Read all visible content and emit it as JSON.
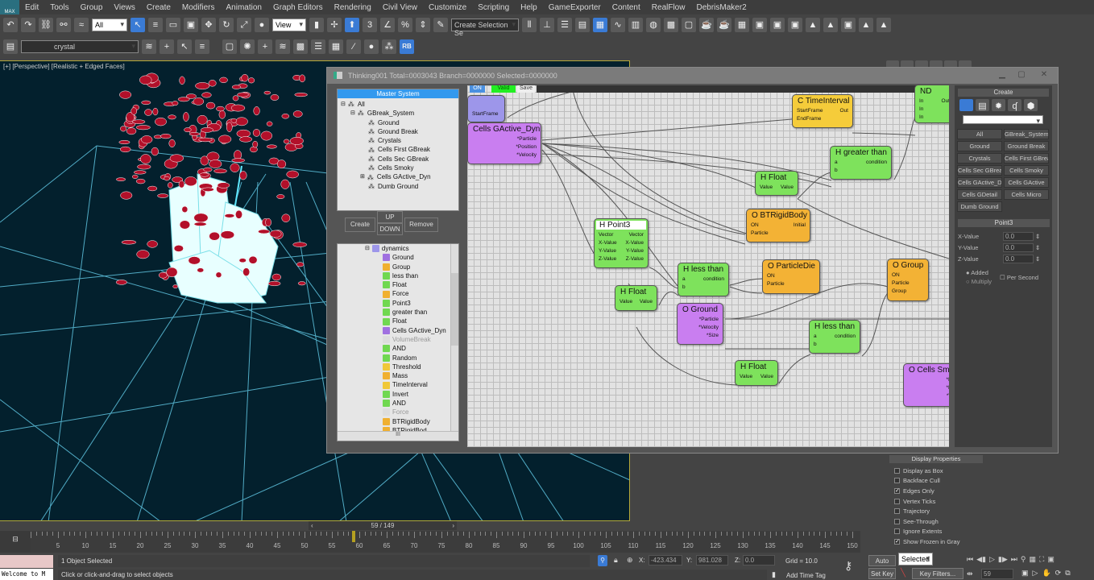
{
  "app": {
    "logo": "MAX"
  },
  "menu": [
    "Edit",
    "Tools",
    "Group",
    "Views",
    "Create",
    "Modifiers",
    "Animation",
    "Graph Editors",
    "Rendering",
    "Civil View",
    "Customize",
    "Scripting",
    "Help",
    "GameExporter",
    "Content",
    "RealFlow",
    "DebrisMaker2"
  ],
  "toolbar": {
    "selection_filter": "All",
    "ref_coord": "View",
    "named_selection": "Create Selection Se",
    "snap_labels": [
      "3",
      "%"
    ],
    "layer": "crystal",
    "rb_label": "RB"
  },
  "viewport": {
    "label": "[+] [Perspective] [Realistic + Edged Faces]"
  },
  "thinking": {
    "title": "Thinking001  Total=0003043  Branch=0000000  Selected=0000000",
    "master_header": "Master System",
    "master_tree": [
      {
        "label": "All",
        "depth": 0,
        "exp": "−"
      },
      {
        "label": "GBreak_System",
        "depth": 1,
        "exp": "−"
      },
      {
        "label": "Ground",
        "depth": 2
      },
      {
        "label": "Ground Break",
        "depth": 2
      },
      {
        "label": "Crystals",
        "depth": 2
      },
      {
        "label": "Cells First GBreak",
        "depth": 2
      },
      {
        "label": "Cells Sec GBreak",
        "depth": 2
      },
      {
        "label": "Cells Smoky",
        "depth": 2
      },
      {
        "label": "Cells GActive_Dyn",
        "depth": 2,
        "exp": "+"
      },
      {
        "label": "Dumb Ground",
        "depth": 2
      }
    ],
    "buttons": {
      "create": "Create",
      "up": "UP",
      "down": "DOWN",
      "remove": "Remove"
    },
    "dyn_root": "dynamics",
    "dyn_list": [
      {
        "label": "Ground",
        "c": "#a070e0"
      },
      {
        "label": "Group",
        "c": "#f0b030"
      },
      {
        "label": "less than",
        "c": "#70d850"
      },
      {
        "label": "Float",
        "c": "#70d850"
      },
      {
        "label": "Force",
        "c": "#f0b030"
      },
      {
        "label": "Point3",
        "c": "#70d850"
      },
      {
        "label": "greater than",
        "c": "#70d850"
      },
      {
        "label": "Float",
        "c": "#70d850"
      },
      {
        "label": "Cells GActive_Dyn",
        "c": "#a070e0"
      },
      {
        "label": "VolumeBreak",
        "c": "#ddd",
        "dim": true
      },
      {
        "label": "AND",
        "c": "#70d850"
      },
      {
        "label": "Random",
        "c": "#70d850"
      },
      {
        "label": "Threshold",
        "c": "#f0c838"
      },
      {
        "label": "Mass",
        "c": "#f0b030"
      },
      {
        "label": "TimeInterval",
        "c": "#f0c838"
      },
      {
        "label": "Invert",
        "c": "#70d850"
      },
      {
        "label": "AND",
        "c": "#70d850"
      },
      {
        "label": "Force",
        "c": "#ddd",
        "dim": true
      },
      {
        "label": "BTRigidBody",
        "c": "#f0b030"
      },
      {
        "label": "BTRigidBod",
        "c": "#f0b030"
      }
    ],
    "hscroll_mark": "III",
    "graph_tabs": {
      "on": "ON",
      "valid": "Valid",
      "save": "Save"
    },
    "nodes": {
      "startframe": {
        "ports": [
          [
            "StartFrame",
            ""
          ]
        ]
      },
      "cells_gactive": {
        "title": "Cells GActive_Dyn",
        "ports": [
          [
            "",
            "*Particle"
          ],
          [
            "",
            "*Position"
          ],
          [
            "",
            "*Velocity"
          ]
        ]
      },
      "timeinterval": {
        "title": "C TimeInterval",
        "ports": [
          [
            "StartFrame",
            "Out"
          ],
          [
            "EndFrame",
            ""
          ]
        ]
      },
      "and": {
        "title": "ND",
        "ports": [
          [
            "In",
            "Out"
          ],
          [
            "In",
            ""
          ],
          [
            "In",
            ""
          ]
        ]
      },
      "greater": {
        "title": "H greater than",
        "ports": [
          [
            "a",
            "condition"
          ],
          [
            "b",
            ""
          ]
        ]
      },
      "float1": {
        "title": "H Float",
        "ports": [
          [
            "Value",
            "Value"
          ]
        ]
      },
      "btrigid": {
        "title": "O BTRigidBody",
        "ports": [
          [
            "ON",
            "Initial"
          ],
          [
            "Particle",
            ""
          ]
        ]
      },
      "point3": {
        "title": "H Point3",
        "ports": [
          [
            "Vector",
            "Vector"
          ],
          [
            "X-Value",
            "X-Value"
          ],
          [
            "Y-Value",
            "Y-Value"
          ],
          [
            "Z-Value",
            "Z-Value"
          ]
        ]
      },
      "less1": {
        "title": "H less than",
        "ports": [
          [
            "a",
            "condition"
          ],
          [
            "b",
            ""
          ]
        ]
      },
      "particledie": {
        "title": "O ParticleDie",
        "ports": [
          [
            "ON",
            ""
          ],
          [
            "Particle",
            ""
          ]
        ]
      },
      "group": {
        "title": "O Group",
        "ports": [
          [
            "ON",
            ""
          ],
          [
            "Particle",
            ""
          ],
          [
            "Group",
            ""
          ]
        ]
      },
      "float2": {
        "title": "H Float",
        "ports": [
          [
            "Value",
            "Value"
          ]
        ]
      },
      "ground": {
        "title": "O Ground",
        "ports": [
          [
            "",
            "*Particle"
          ],
          [
            "",
            "*Velocity"
          ],
          [
            "",
            "*Size"
          ]
        ]
      },
      "less2": {
        "title": "H less than",
        "ports": [
          [
            "a",
            "condition"
          ],
          [
            "b",
            ""
          ]
        ]
      },
      "float3": {
        "title": "H Float",
        "ports": [
          [
            "Value",
            "Value"
          ]
        ]
      },
      "cellssm": {
        "title": "O Cells Sm",
        "ports": [
          [
            "",
            "*Pa"
          ],
          [
            "",
            "*Po"
          ],
          [
            "",
            "*Ve"
          ]
        ]
      }
    },
    "create_header": "Create",
    "create_buttons": [
      "All",
      "GBreak_System",
      "Ground",
      "Ground Break",
      "Crystals",
      "Cells First GBreak",
      "Cells Sec GBreak",
      "Cells Smoky",
      "Cells GActive_Dyn",
      "Cells GActive",
      "Cells GDetail",
      "Cells Micro",
      "Dumb Ground"
    ],
    "point3_header": "Point3",
    "point3_fields": [
      {
        "label": "X-Value",
        "value": "0.0"
      },
      {
        "label": "Y-Value",
        "value": "0.0"
      },
      {
        "label": "Z-Value",
        "value": "0.0"
      }
    ],
    "mode_added": "Added",
    "mode_multiply": "Multiply",
    "per_second": "Per Second"
  },
  "display_props": {
    "header": "Display Properties",
    "items": [
      {
        "label": "Display as Box",
        "checked": false
      },
      {
        "label": "Backface Cull",
        "checked": false
      },
      {
        "label": "Edges Only",
        "checked": true
      },
      {
        "label": "Vertex Ticks",
        "checked": false
      },
      {
        "label": "Trajectory",
        "checked": false
      },
      {
        "label": "See-Through",
        "checked": false
      },
      {
        "label": "Ignore Extents",
        "checked": false
      },
      {
        "label": "Show Frozen in Gray",
        "checked": true
      }
    ]
  },
  "timeline": {
    "slider": "59 / 149",
    "current_frame": 59,
    "max_frame": 150,
    "ticks": [
      5,
      10,
      15,
      20,
      25,
      30,
      35,
      40,
      45,
      50,
      55,
      60,
      65,
      70,
      75,
      80,
      85,
      90,
      95,
      100,
      105,
      110,
      115,
      120,
      125,
      130,
      135,
      140,
      145,
      150
    ]
  },
  "status": {
    "maxscript": "Welcome to M",
    "selected": "1 Object Selected",
    "prompt": "Click or click-and-drag to select objects",
    "x_label": "X:",
    "x": "-423.434",
    "y_label": "Y:",
    "y": "981.028",
    "z_label": "Z:",
    "z": "0.0",
    "grid": "Grid = 10.0",
    "add_time_tag": "Add Time Tag",
    "auto_key": "Auto Key",
    "set_key": "Set Key",
    "key_mode": "Selected",
    "key_filters": "Key Filters...",
    "frame": "59"
  }
}
